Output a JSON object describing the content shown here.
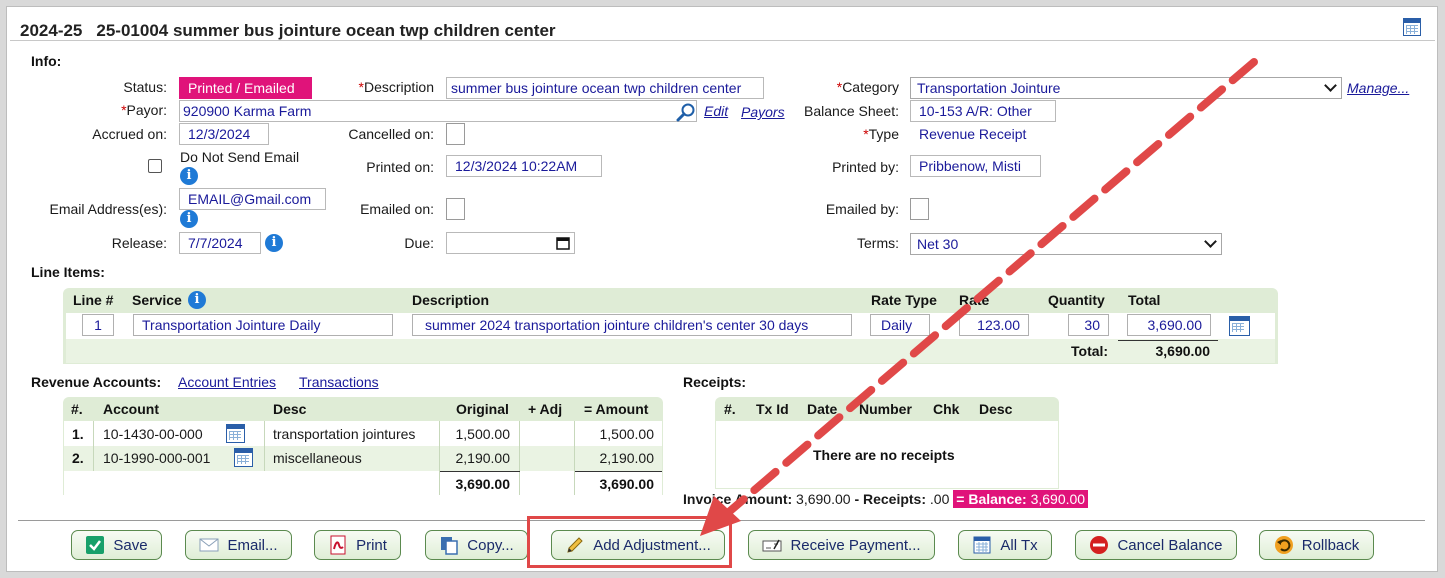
{
  "header": {
    "year": "2024-25",
    "title": "25-01004 summer bus jointure ocean twp children center"
  },
  "info": {
    "section_label": "Info:",
    "status_label": "Status:",
    "status_value": "Printed / Emailed",
    "description_label": "Description",
    "description_value": "summer bus jointure ocean twp children center",
    "category_label": "Category",
    "category_value": "Transportation Jointure",
    "manage_link": "Manage...",
    "payor_label": "Payor:",
    "payor_value": "920900 Karma Farm",
    "edit_link": "Edit",
    "payors_link": "Payors",
    "balance_sheet_label": "Balance Sheet:",
    "balance_sheet_value": "10-153 A/R: Other",
    "accrued_label": "Accrued on:",
    "accrued_value": "12/3/2024",
    "cancelled_label": "Cancelled on:",
    "type_label": "Type",
    "type_value": "Revenue Receipt",
    "do_not_send_label": "Do Not Send Email",
    "printed_on_label": "Printed on:",
    "printed_on_value": "12/3/2024 10:22AM",
    "printed_by_label": "Printed by:",
    "printed_by_value": "Pribbenow, Misti",
    "email_label": "Email Address(es):",
    "email_value": "EMAIL@Gmail.com",
    "emailed_on_label": "Emailed on:",
    "emailed_by_label": "Emailed by:",
    "release_label": "Release:",
    "release_value": "7/7/2024",
    "due_label": "Due:",
    "terms_label": "Terms:",
    "terms_value": "Net 30"
  },
  "line_items": {
    "section_label": "Line Items:",
    "headers": [
      "Line #",
      "Service",
      "Description",
      "Rate Type",
      "Rate",
      "Quantity",
      "Total"
    ],
    "rows": [
      {
        "line": "1",
        "service": "Transportation Jointure Daily",
        "description": "summer 2024 transportation jointure children's center 30 days",
        "rate_type": "Daily",
        "rate": "123.00",
        "quantity": "30",
        "total": "3,690.00"
      }
    ],
    "total_label": "Total:",
    "total_value": "3,690.00"
  },
  "revenue": {
    "section_label": "Revenue Accounts:",
    "account_entries_link": "Account Entries",
    "transactions_link": "Transactions",
    "headers": [
      "#.",
      "Account",
      "Desc",
      "Original",
      "+ Adj",
      "= Amount"
    ],
    "rows": [
      {
        "num": "1.",
        "account": "10-1430-00-000",
        "desc": "transportation jointures",
        "original": "1,500.00",
        "adj": "",
        "amount": "1,500.00"
      },
      {
        "num": "2.",
        "account": "10-1990-000-001",
        "desc": "miscellaneous",
        "original": "2,190.00",
        "adj": "",
        "amount": "2,190.00"
      }
    ],
    "total_original": "3,690.00",
    "total_amount": "3,690.00"
  },
  "receipts": {
    "section_label": "Receipts:",
    "headers": [
      "#.",
      "Tx Id",
      "Date",
      "Number",
      "Chk",
      "Desc"
    ],
    "empty_text": "There are no receipts",
    "invoice_amount_label": "Invoice Amount:",
    "invoice_amount_value": "3,690.00",
    "receipts_label": "- Receipts:",
    "receipts_value": ".00",
    "balance_label": "= Balance:",
    "balance_value": "3,690.00"
  },
  "buttons": {
    "save": "Save",
    "email": "Email...",
    "print": "Print",
    "copy": "Copy...",
    "add_adjustment": "Add Adjustment...",
    "receive_payment": "Receive Payment...",
    "all_tx": "All Tx",
    "cancel_balance": "Cancel Balance",
    "rollback": "Rollback"
  },
  "colors": {
    "status_pink": "#e0137a",
    "grid_green": "#dfecd6",
    "link_blue": "#1a1a9a",
    "annotation_red": "#e04848"
  }
}
